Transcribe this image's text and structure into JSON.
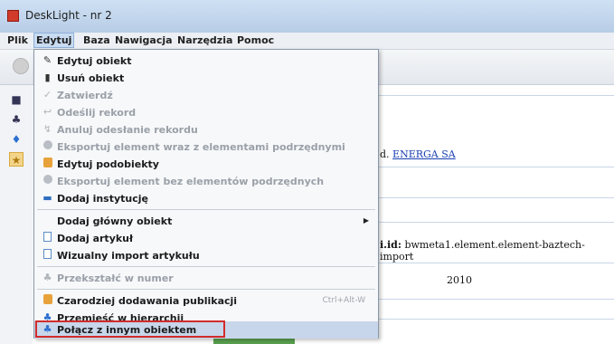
{
  "window": {
    "title": "DeskLight - nr 2"
  },
  "menubar": {
    "items": [
      "Plik",
      "Edytuj",
      "Baza",
      "Nawigacja",
      "Narzędzia",
      "Pomoc"
    ],
    "active": "Edytuj"
  },
  "background": {
    "affiliation_suffix": "d.",
    "affiliation_link": "ENERGA SA",
    "id_label": "i.id:",
    "id_value": "bwmeta1.element.element-baztech-import",
    "year": "2010"
  },
  "edit_menu": {
    "items": [
      {
        "label": "Edytuj obiekt",
        "icon": "edit-icon",
        "enabled": true
      },
      {
        "label": "Usuń obiekt",
        "icon": "trash-icon",
        "enabled": true
      },
      {
        "label": "Zatwierdź",
        "icon": "check-icon",
        "enabled": false
      },
      {
        "label": "Odeślij rekord",
        "icon": "send-back-icon",
        "enabled": false
      },
      {
        "label": "Anuluj odesłanie rekordu",
        "icon": "cancel-send-icon",
        "enabled": false
      },
      {
        "label": "Eksportuj element wraz z elementami podrzędnymi",
        "icon": "export-icon",
        "enabled": false
      },
      {
        "label": "Edytuj podobiekty",
        "icon": "subobjects-icon",
        "enabled": true
      },
      {
        "label": "Eksportuj element bez elementów podrzędnych",
        "icon": "export-icon",
        "enabled": false
      },
      {
        "label": "Dodaj instytucję",
        "icon": "institution-icon",
        "enabled": true
      },
      {
        "label": "Dodaj główny obiekt",
        "icon": "",
        "enabled": true,
        "submenu": true
      },
      {
        "label": "Dodaj artykuł",
        "icon": "document-icon",
        "enabled": true
      },
      {
        "label": "Wizualny import artykułu",
        "icon": "document-icon",
        "enabled": true
      },
      {
        "label": "Przekształć w numer",
        "icon": "hierarchy-icon",
        "enabled": false
      },
      {
        "label": "Czarodziej dodawania publikacji",
        "icon": "wizard-icon",
        "enabled": true,
        "shortcut": "Ctrl+Alt-W"
      },
      {
        "label": "Przemieść w hierarchii",
        "icon": "hierarchy-icon",
        "enabled": true
      },
      {
        "label": "Połącz z innym obiektem",
        "icon": "hierarchy-icon",
        "enabled": true,
        "highlighted": true
      }
    ]
  },
  "colors": {
    "highlight_box": "#d22b2b",
    "menu_highlight": "#c7d6ea",
    "link": "#1a3fb3"
  }
}
